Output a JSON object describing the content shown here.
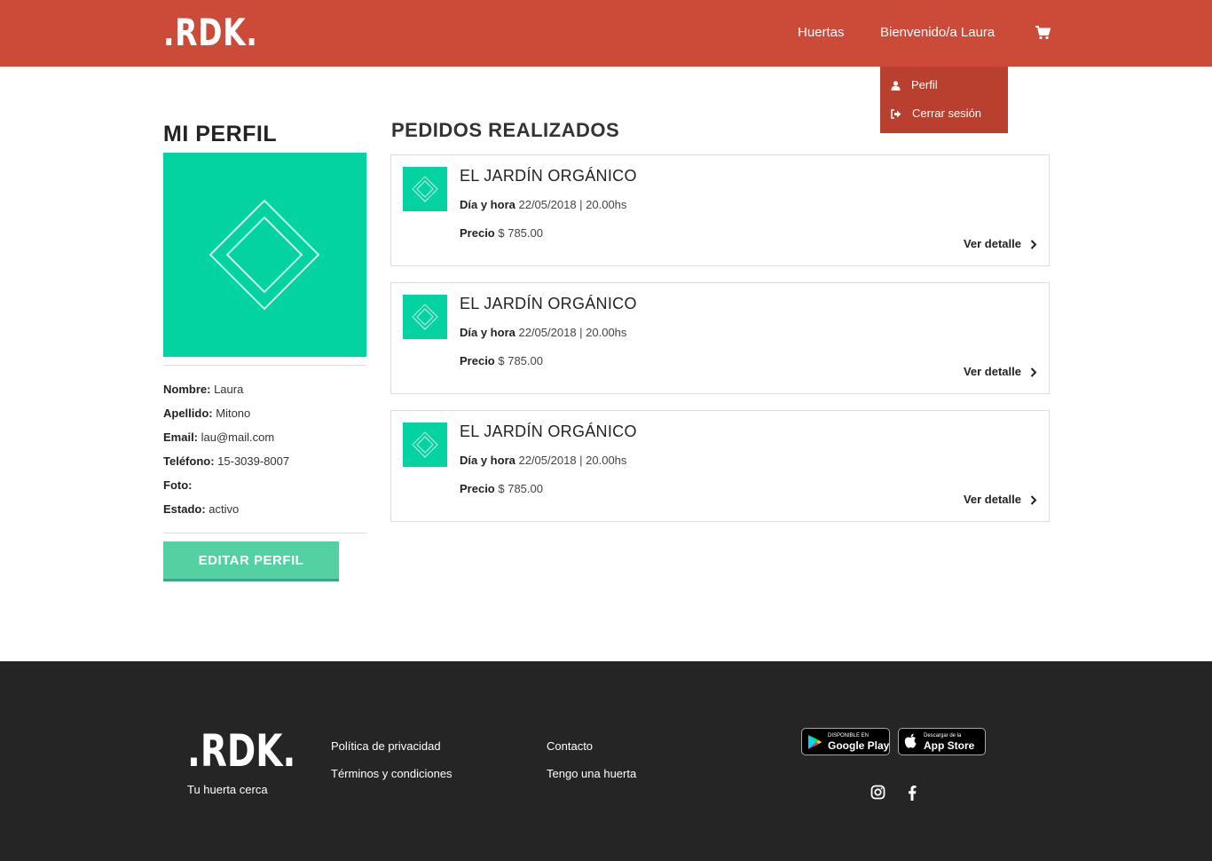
{
  "header": {
    "logo": ".RDK.",
    "nav": {
      "huertas": "Huertas",
      "welcome": "Bienvenido/a Laura"
    },
    "cart_icon": "cart-icon",
    "accent_color": "#cc4b38"
  },
  "dropdown": {
    "items": [
      {
        "label": "Perfil",
        "icon": "user-icon"
      },
      {
        "label": "Cerrar sesión",
        "icon": "logout-icon"
      }
    ]
  },
  "profile": {
    "heading": "MI PERFIL",
    "fields": [
      {
        "label": "Nombre:",
        "value": "Laura"
      },
      {
        "label": "Apellido:",
        "value": "Mitono"
      },
      {
        "label": "Email:",
        "value": "lau@mail.com"
      },
      {
        "label": "Teléfono:",
        "value": "15-3039-8007"
      },
      {
        "label": "Foto:",
        "value": ""
      },
      {
        "label": "Estado:",
        "value": "activo"
      }
    ],
    "edit_label": "EDITAR PERFIL",
    "avatar_color": "#02d3a0"
  },
  "orders": {
    "heading": "PEDIDOS REALIZADOS",
    "items": [
      {
        "title": "EL JARDÍN ORGÁNICO",
        "date_label": "Día y hora",
        "date_value": "22/05/2018 | 20.00hs",
        "price_label": "Precio",
        "price_value": "$ 785.00",
        "detail_label": "Ver detalle"
      },
      {
        "title": "EL JARDÍN ORGÁNICO",
        "date_label": "Día y hora",
        "date_value": "22/05/2018 | 20.00hs",
        "price_label": "Precio",
        "price_value": "$ 785.00",
        "detail_label": "Ver detalle"
      },
      {
        "title": "EL JARDÍN ORGÁNICO",
        "date_label": "Día y hora",
        "date_value": "22/05/2018 | 20.00hs",
        "price_label": "Precio",
        "price_value": "$ 785.00",
        "detail_label": "Ver detalle"
      }
    ]
  },
  "footer": {
    "logo": ".RDK.",
    "tagline": "Tu huerta cerca",
    "links": {
      "privacy": "Política de privacidad",
      "terms": "Términos y condiciones",
      "contact": "Contacto",
      "own_garden": "Tengo una huerta"
    },
    "google_play": {
      "small": "DISPONIBLE EN",
      "big": "Google Play"
    },
    "app_store": {
      "small": "Descargar de la",
      "big": "App Store"
    },
    "social_icons": [
      "instagram-icon",
      "facebook-icon"
    ],
    "background_color": "#252525"
  }
}
